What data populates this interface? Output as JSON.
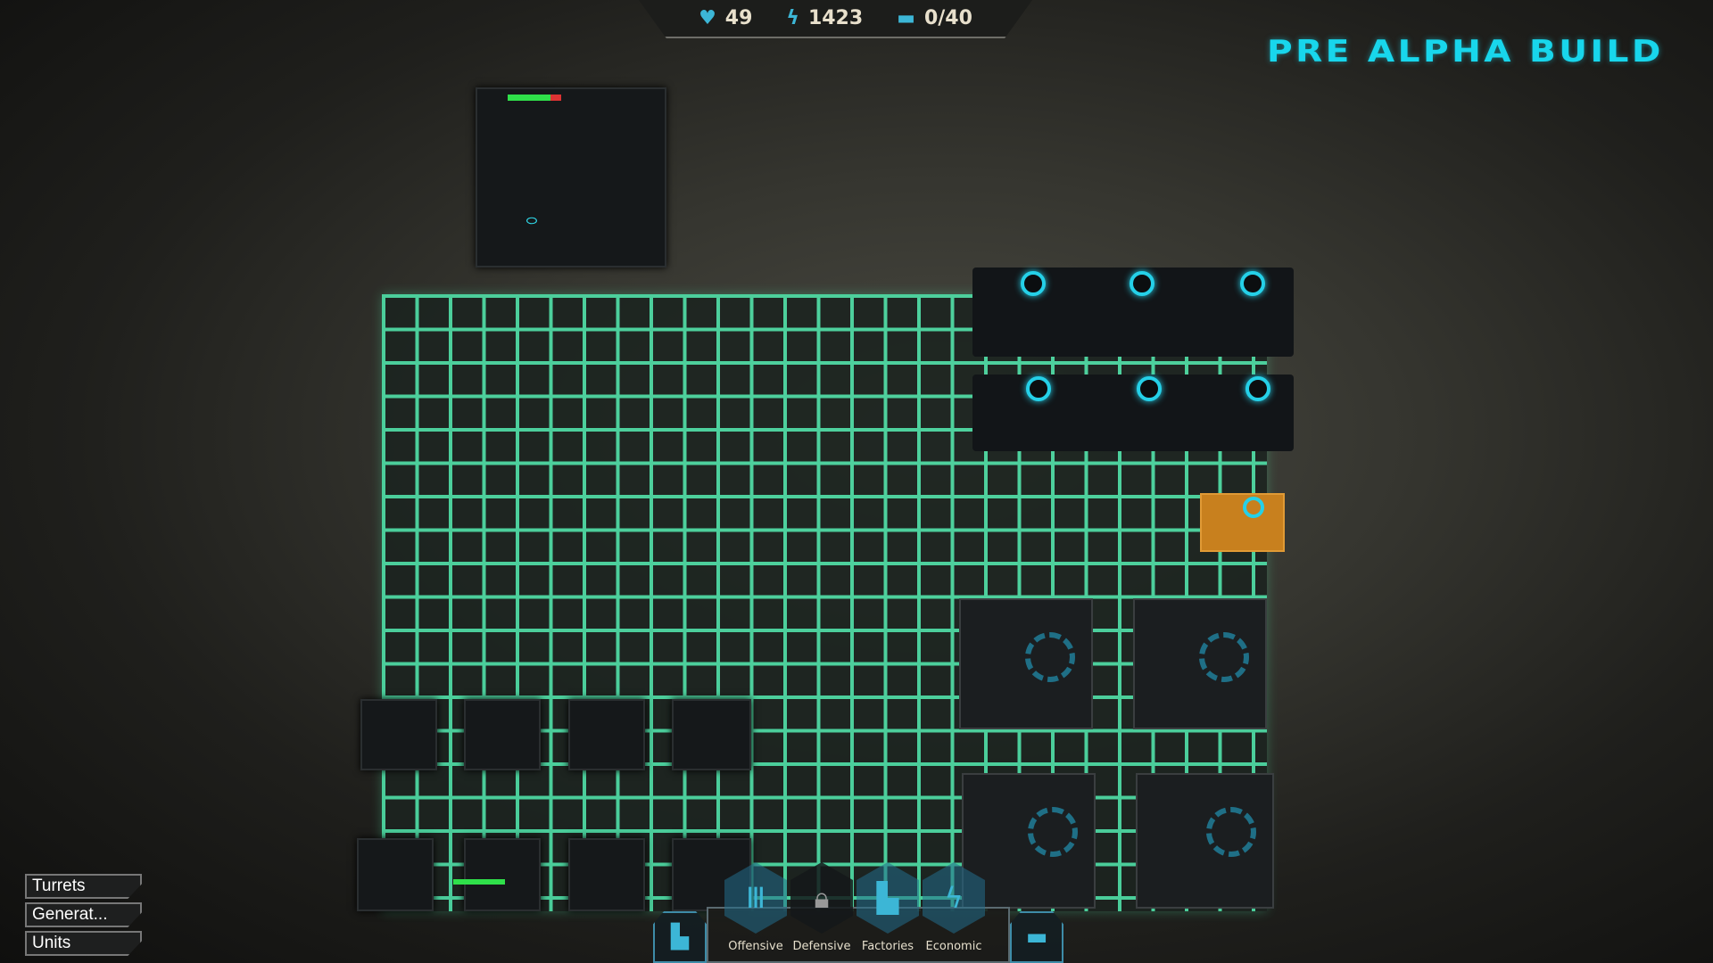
{
  "hud": {
    "health": "49",
    "energy": "1423",
    "units": "0/40",
    "icons": {
      "health": "heart-icon",
      "energy": "lightning-icon",
      "units": "tank-icon"
    }
  },
  "build_label": "PRE ALPHA BUILD",
  "menu": [
    {
      "label": "Turrets"
    },
    {
      "label": "Generat..."
    },
    {
      "label": "Units"
    }
  ],
  "build_panel": {
    "categories": [
      {
        "label": "Offensive",
        "icon": "turret-icon",
        "locked": false
      },
      {
        "label": "Defensive",
        "icon": "lock-icon",
        "locked": true
      },
      {
        "label": "Factories",
        "icon": "factory-icon",
        "locked": false
      },
      {
        "label": "Economic",
        "icon": "lightning-icon",
        "locked": false
      }
    ]
  },
  "colors": {
    "accent": "#18d6ec",
    "grid": "#4fe0a8",
    "selected": "#c8801e"
  }
}
